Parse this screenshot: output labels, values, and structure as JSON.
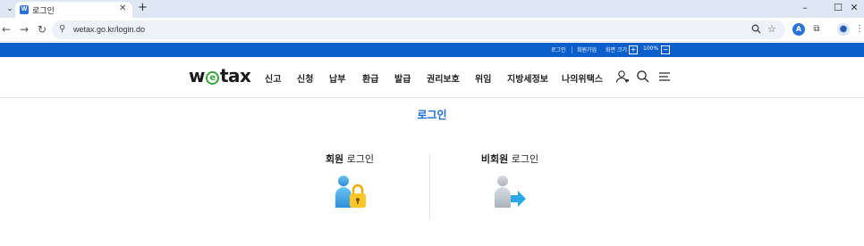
{
  "browser": {
    "tab_title": "로그인",
    "tab_favicon_letter": "W",
    "url": "wetax.go.kr/login.do"
  },
  "utility": {
    "login": "로그인",
    "signup": "회원가입",
    "screen_size": "화면 크기",
    "zoom_in": "+",
    "zoom_level": "100%",
    "zoom_out": "−"
  },
  "header": {
    "logo_w": "w",
    "logo_e": "e",
    "logo_rest": "tax",
    "menu": [
      "신고",
      "신청",
      "납부",
      "환급",
      "발급",
      "권리보호",
      "위임",
      "지방세정보",
      "나의위택스"
    ]
  },
  "main": {
    "page_title": "로그인",
    "member": {
      "strong": "회원",
      "rest": " 로그인"
    },
    "nonmember": {
      "strong": "비회원",
      "rest": " 로그인"
    }
  },
  "colors": {
    "brand_blue": "#0c5fcb",
    "title_blue": "#1a6ad6",
    "logo_green": "#3aa33a"
  },
  "icons": [
    "tab-menu-icon",
    "favicon-icon",
    "close-icon",
    "new-tab-icon",
    "minimize-icon",
    "maximize-icon",
    "window-close-icon",
    "back-icon",
    "forward-icon",
    "reload-icon",
    "site-info-icon",
    "zoom-icon",
    "bookmark-star-icon",
    "extension-a-icon",
    "extensions-puzzle-icon",
    "profile-icon",
    "browser-menu-icon",
    "user-icon",
    "search-icon",
    "hamburger-menu-icon",
    "member-lock-icon",
    "nonmember-arrow-icon"
  ]
}
